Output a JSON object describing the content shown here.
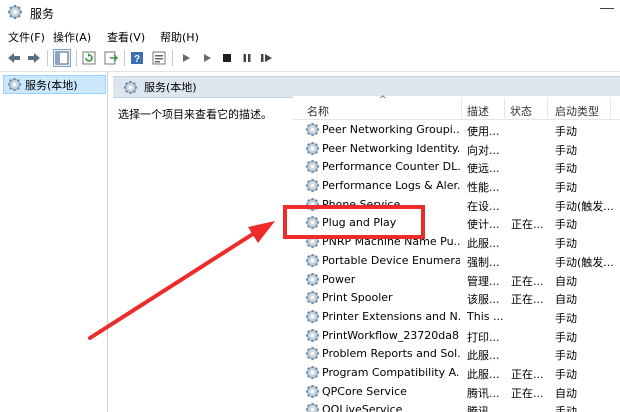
{
  "window": {
    "title": "服务",
    "app_icon": "gear-services-icon"
  },
  "menu": {
    "items": [
      "文件(F)",
      "操作(A)",
      "查看(V)",
      "帮助(H)"
    ]
  },
  "toolbar": {
    "buttons": [
      "back-arrow-icon",
      "forward-arrow-icon",
      "show-tree-icon",
      "refresh-icon",
      "export-icon",
      "help-icon",
      "properties-icon",
      "start-icon",
      "start-alt-icon",
      "stop-icon",
      "pause-icon",
      "restart-icon"
    ]
  },
  "tree": {
    "root_label": "服务(本地)"
  },
  "pane": {
    "header": "服务(本地)",
    "description_prompt": "选择一个项目来查看它的描述。"
  },
  "columns": {
    "name": "名称",
    "desc": "描述",
    "status": "状态",
    "start": "启动类型"
  },
  "services": [
    {
      "name": "Peer Networking Groupi...",
      "desc": "使用...",
      "status": "",
      "start": "手动"
    },
    {
      "name": "Peer Networking Identity...",
      "desc": "向对...",
      "status": "",
      "start": "手动"
    },
    {
      "name": "Performance Counter DL...",
      "desc": "使远...",
      "status": "",
      "start": "手动"
    },
    {
      "name": "Performance Logs & Aler...",
      "desc": "性能...",
      "status": "",
      "start": "手动"
    },
    {
      "name": "Phone Service",
      "desc": "在设...",
      "status": "",
      "start": "手动(触发..."
    },
    {
      "name": "Plug and Play",
      "desc": "使计...",
      "status": "正在...",
      "start": "手动"
    },
    {
      "name": "PNRP Machine Name Pu...",
      "desc": "此服...",
      "status": "",
      "start": "手动"
    },
    {
      "name": "Portable Device Enumera...",
      "desc": "强制...",
      "status": "",
      "start": "手动(触发..."
    },
    {
      "name": "Power",
      "desc": "管理...",
      "status": "正在...",
      "start": "自动"
    },
    {
      "name": "Print Spooler",
      "desc": "该服...",
      "status": "正在...",
      "start": "自动"
    },
    {
      "name": "Printer Extensions and N...",
      "desc": "This ...",
      "status": "",
      "start": "手动"
    },
    {
      "name": "PrintWorkflow_23720da8",
      "desc": "打印...",
      "status": "",
      "start": "手动"
    },
    {
      "name": "Problem Reports and Sol...",
      "desc": "此服...",
      "status": "",
      "start": "手动"
    },
    {
      "name": "Program Compatibility A...",
      "desc": "此服...",
      "status": "正在...",
      "start": "手动"
    },
    {
      "name": "QPCore Service",
      "desc": "腾讯...",
      "status": "正在...",
      "start": "自动"
    },
    {
      "name": "QQLiveService",
      "desc": "腾讯...",
      "status": "",
      "start": "手动"
    }
  ],
  "annotation": {
    "highlighted_service": "Plug and Play",
    "color": "#ee2a2a"
  }
}
